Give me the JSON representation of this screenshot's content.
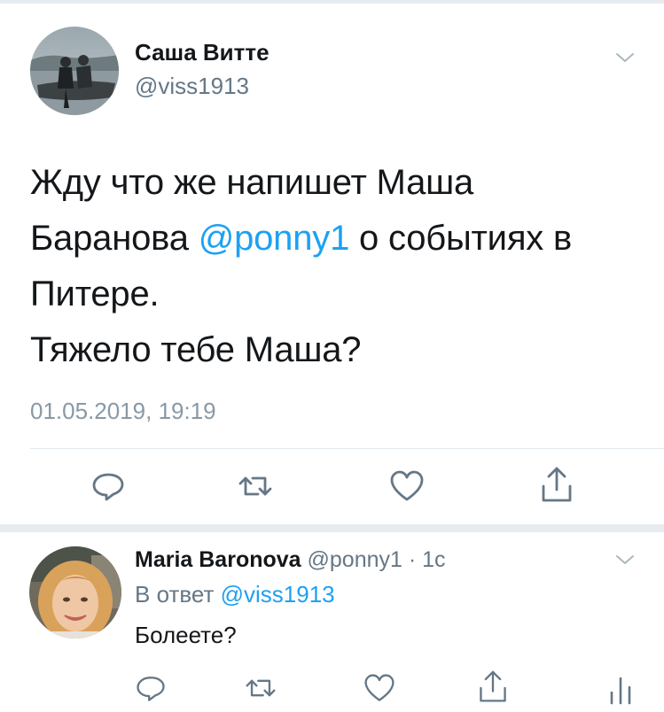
{
  "main_tweet": {
    "display_name": "Саша Витте",
    "handle": "@viss1913",
    "lines": [
      {
        "before": "Жду что же напишет Маша",
        "mention": "",
        "after": ""
      },
      {
        "before": "Баранова ",
        "mention": "@ponny1",
        "after": " о событиях в"
      },
      {
        "before": "Питере.",
        "mention": "",
        "after": ""
      },
      {
        "before": "Тяжело тебе Маша?",
        "mention": "",
        "after": ""
      }
    ],
    "timestamp": "01.05.2019, 19:19",
    "actions": [
      "reply-icon",
      "retweet-icon",
      "like-icon",
      "share-icon"
    ]
  },
  "reply_tweet": {
    "display_name": "Maria Baronova",
    "handle": "@ponny1",
    "separator": " · ",
    "time": "1с",
    "reply_prefix": "В ответ ",
    "reply_mention": "@viss1913",
    "text": "Болеете?",
    "actions": [
      "reply-icon",
      "retweet-icon",
      "like-icon",
      "share-icon",
      "stats-icon"
    ]
  },
  "colors": {
    "link": "#1da1f2",
    "secondary_text": "#657786",
    "icon": "#657786",
    "separator": "#e6ecf0"
  }
}
